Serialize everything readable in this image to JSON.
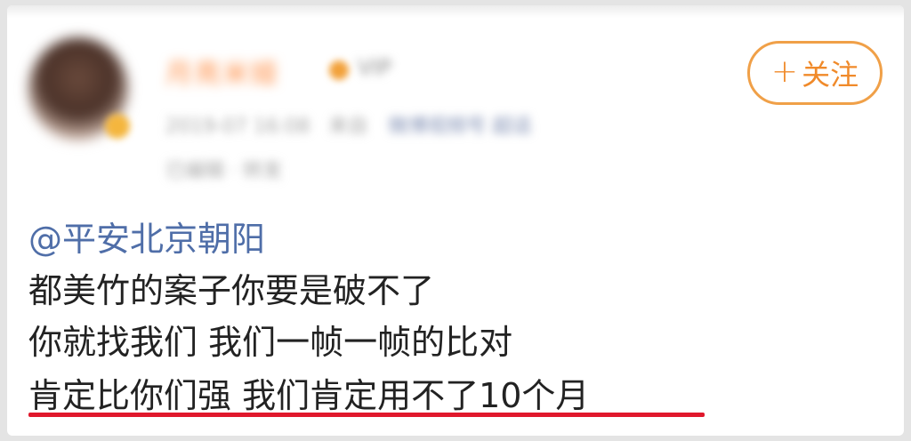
{
  "user": {
    "name": "月亮米娅",
    "name_tag": "VIP",
    "meta": "2019-07 16:08",
    "meta_source": "来自",
    "meta_link": "微博视频号 超话",
    "meta2": "已编辑 · 转发"
  },
  "follow_button": {
    "plus": "+",
    "label": "关注"
  },
  "post": {
    "mention": "@平安北京朝阳",
    "line1": "都美竹的案子你要是破不了",
    "line2": "你就找我们  我们一帧一帧的比对",
    "line3": "肯定比你们强  我们肯定用不了10个月"
  },
  "colors": {
    "accent": "#f08a2a",
    "mention": "#4f6ea8",
    "underline": "#e0182c"
  }
}
